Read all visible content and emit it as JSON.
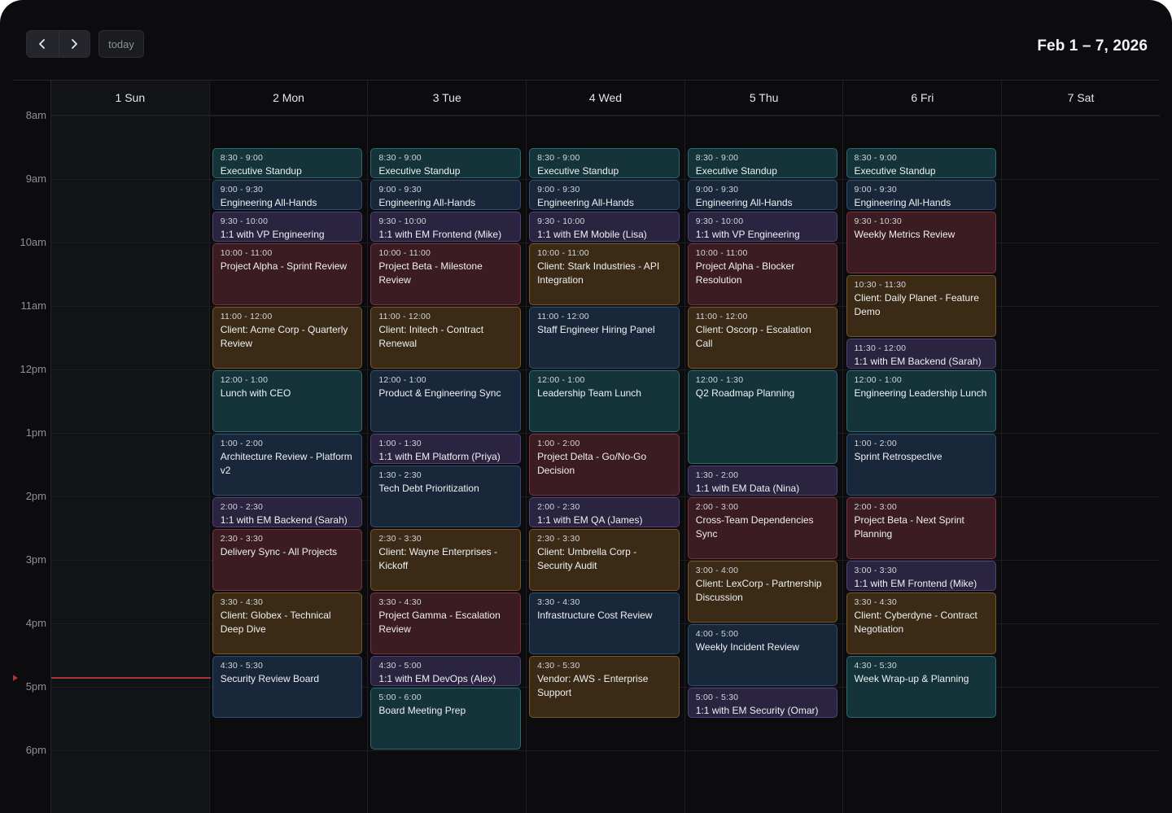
{
  "toolbar": {
    "today_label": "today",
    "range_title": "Feb 1 – 7, 2026",
    "prev_icon": "chevron-left-icon",
    "next_icon": "chevron-right-icon"
  },
  "days": [
    "1 Sun",
    "2 Mon",
    "3 Tue",
    "4 Wed",
    "5 Thu",
    "6 Fri",
    "7 Sat"
  ],
  "hours": [
    "8am",
    "9am",
    "10am",
    "11am",
    "12pm",
    "1pm",
    "2pm",
    "3pm",
    "4pm",
    "5pm",
    "6pm"
  ],
  "colors": {
    "teal": "#14343a",
    "navy": "#18283a",
    "purple": "#2a2440",
    "red": "#3a1c22",
    "amber": "#3a2a16",
    "now": "#a8353a"
  },
  "events": [
    {
      "day": 1,
      "start": 8.5,
      "end": 9,
      "time": "8:30 - 9:00",
      "title": "Executive Standup",
      "color": "teal"
    },
    {
      "day": 1,
      "start": 9,
      "end": 9.5,
      "time": "9:00 - 9:30",
      "title": "Engineering All-Hands",
      "color": "navy"
    },
    {
      "day": 1,
      "start": 9.5,
      "end": 10,
      "time": "9:30 - 10:00",
      "title": "1:1 with VP Engineering",
      "color": "purple"
    },
    {
      "day": 1,
      "start": 10,
      "end": 11,
      "time": "10:00 - 11:00",
      "title": "Project Alpha - Sprint Review",
      "color": "red"
    },
    {
      "day": 1,
      "start": 11,
      "end": 12,
      "time": "11:00 - 12:00",
      "title": "Client: Acme Corp - Quarterly Review",
      "color": "amber"
    },
    {
      "day": 1,
      "start": 12,
      "end": 13,
      "time": "12:00 - 1:00",
      "title": "Lunch with CEO",
      "color": "teal"
    },
    {
      "day": 1,
      "start": 13,
      "end": 14,
      "time": "1:00 - 2:00",
      "title": "Architecture Review - Platform v2",
      "color": "navy"
    },
    {
      "day": 1,
      "start": 14,
      "end": 14.5,
      "time": "2:00 - 2:30",
      "title": "1:1 with EM Backend (Sarah)",
      "color": "purple"
    },
    {
      "day": 1,
      "start": 14.5,
      "end": 15.5,
      "time": "2:30 - 3:30",
      "title": "Delivery Sync - All Projects",
      "color": "red"
    },
    {
      "day": 1,
      "start": 15.5,
      "end": 16.5,
      "time": "3:30 - 4:30",
      "title": "Client: Globex - Technical Deep Dive",
      "color": "amber"
    },
    {
      "day": 1,
      "start": 16.5,
      "end": 17.5,
      "time": "4:30 - 5:30",
      "title": "Security Review Board",
      "color": "navy"
    },
    {
      "day": 2,
      "start": 8.5,
      "end": 9,
      "time": "8:30 - 9:00",
      "title": "Executive Standup",
      "color": "teal"
    },
    {
      "day": 2,
      "start": 9,
      "end": 9.5,
      "time": "9:00 - 9:30",
      "title": "Engineering All-Hands",
      "color": "navy"
    },
    {
      "day": 2,
      "start": 9.5,
      "end": 10,
      "time": "9:30 - 10:00",
      "title": "1:1 with EM Frontend (Mike)",
      "color": "purple"
    },
    {
      "day": 2,
      "start": 10,
      "end": 11,
      "time": "10:00 - 11:00",
      "title": "Project Beta - Milestone Review",
      "color": "red"
    },
    {
      "day": 2,
      "start": 11,
      "end": 12,
      "time": "11:00 - 12:00",
      "title": "Client: Initech - Contract Renewal",
      "color": "amber"
    },
    {
      "day": 2,
      "start": 12,
      "end": 13,
      "time": "12:00 - 1:00",
      "title": "Product & Engineering Sync",
      "color": "navy"
    },
    {
      "day": 2,
      "start": 13,
      "end": 13.5,
      "time": "1:00 - 1:30",
      "title": "1:1 with EM Platform (Priya)",
      "color": "purple"
    },
    {
      "day": 2,
      "start": 13.5,
      "end": 14.5,
      "time": "1:30 - 2:30",
      "title": "Tech Debt Prioritization",
      "color": "navy"
    },
    {
      "day": 2,
      "start": 14.5,
      "end": 15.5,
      "time": "2:30 - 3:30",
      "title": "Client: Wayne Enterprises - Kickoff",
      "color": "amber"
    },
    {
      "day": 2,
      "start": 15.5,
      "end": 16.5,
      "time": "3:30 - 4:30",
      "title": "Project Gamma - Escalation Review",
      "color": "red"
    },
    {
      "day": 2,
      "start": 16.5,
      "end": 17,
      "time": "4:30 - 5:00",
      "title": "1:1 with EM DevOps (Alex)",
      "color": "purple"
    },
    {
      "day": 2,
      "start": 17,
      "end": 18,
      "time": "5:00 - 6:00",
      "title": "Board Meeting Prep",
      "color": "teal"
    },
    {
      "day": 3,
      "start": 8.5,
      "end": 9,
      "time": "8:30 - 9:00",
      "title": "Executive Standup",
      "color": "teal"
    },
    {
      "day": 3,
      "start": 9,
      "end": 9.5,
      "time": "9:00 - 9:30",
      "title": "Engineering All-Hands",
      "color": "navy"
    },
    {
      "day": 3,
      "start": 9.5,
      "end": 10,
      "time": "9:30 - 10:00",
      "title": "1:1 with EM Mobile (Lisa)",
      "color": "purple"
    },
    {
      "day": 3,
      "start": 10,
      "end": 11,
      "time": "10:00 - 11:00",
      "title": "Client: Stark Industries - API Integration",
      "color": "amber"
    },
    {
      "day": 3,
      "start": 11,
      "end": 12,
      "time": "11:00 - 12:00",
      "title": "Staff Engineer Hiring Panel",
      "color": "navy"
    },
    {
      "day": 3,
      "start": 12,
      "end": 13,
      "time": "12:00 - 1:00",
      "title": "Leadership Team Lunch",
      "color": "teal"
    },
    {
      "day": 3,
      "start": 13,
      "end": 14,
      "time": "1:00 - 2:00",
      "title": "Project Delta - Go/No-Go Decision",
      "color": "red"
    },
    {
      "day": 3,
      "start": 14,
      "end": 14.5,
      "time": "2:00 - 2:30",
      "title": "1:1 with EM QA (James)",
      "color": "purple"
    },
    {
      "day": 3,
      "start": 14.5,
      "end": 15.5,
      "time": "2:30 - 3:30",
      "title": "Client: Umbrella Corp - Security Audit",
      "color": "amber"
    },
    {
      "day": 3,
      "start": 15.5,
      "end": 16.5,
      "time": "3:30 - 4:30",
      "title": "Infrastructure Cost Review",
      "color": "navy"
    },
    {
      "day": 3,
      "start": 16.5,
      "end": 17.5,
      "time": "4:30 - 5:30",
      "title": "Vendor: AWS - Enterprise Support",
      "color": "amber"
    },
    {
      "day": 4,
      "start": 8.5,
      "end": 9,
      "time": "8:30 - 9:00",
      "title": "Executive Standup",
      "color": "teal"
    },
    {
      "day": 4,
      "start": 9,
      "end": 9.5,
      "time": "9:00 - 9:30",
      "title": "Engineering All-Hands",
      "color": "navy"
    },
    {
      "day": 4,
      "start": 9.5,
      "end": 10,
      "time": "9:30 - 10:00",
      "title": "1:1 with VP Engineering",
      "color": "purple"
    },
    {
      "day": 4,
      "start": 10,
      "end": 11,
      "time": "10:00 - 11:00",
      "title": "Project Alpha - Blocker Resolution",
      "color": "red"
    },
    {
      "day": 4,
      "start": 11,
      "end": 12,
      "time": "11:00 - 12:00",
      "title": "Client: Oscorp - Escalation Call",
      "color": "amber"
    },
    {
      "day": 4,
      "start": 12,
      "end": 13.5,
      "time": "12:00 - 1:30",
      "title": "Q2 Roadmap Planning",
      "color": "teal"
    },
    {
      "day": 4,
      "start": 13.5,
      "end": 14,
      "time": "1:30 - 2:00",
      "title": "1:1 with EM Data (Nina)",
      "color": "purple"
    },
    {
      "day": 4,
      "start": 14,
      "end": 15,
      "time": "2:00 - 3:00",
      "title": "Cross-Team Dependencies Sync",
      "color": "red"
    },
    {
      "day": 4,
      "start": 15,
      "end": 16,
      "time": "3:00 - 4:00",
      "title": "Client: LexCorp - Partnership Discussion",
      "color": "amber"
    },
    {
      "day": 4,
      "start": 16,
      "end": 17,
      "time": "4:00 - 5:00",
      "title": "Weekly Incident Review",
      "color": "navy"
    },
    {
      "day": 4,
      "start": 17,
      "end": 17.5,
      "time": "5:00 - 5:30",
      "title": "1:1 with EM Security (Omar)",
      "color": "purple"
    },
    {
      "day": 5,
      "start": 8.5,
      "end": 9,
      "time": "8:30 - 9:00",
      "title": "Executive Standup",
      "color": "teal"
    },
    {
      "day": 5,
      "start": 9,
      "end": 9.5,
      "time": "9:00 - 9:30",
      "title": "Engineering All-Hands",
      "color": "navy"
    },
    {
      "day": 5,
      "start": 9.5,
      "end": 10.5,
      "time": "9:30 - 10:30",
      "title": "Weekly Metrics Review",
      "color": "red"
    },
    {
      "day": 5,
      "start": 10.5,
      "end": 11.5,
      "time": "10:30 - 11:30",
      "title": "Client: Daily Planet - Feature Demo",
      "color": "amber"
    },
    {
      "day": 5,
      "start": 11.5,
      "end": 12,
      "time": "11:30 - 12:00",
      "title": "1:1 with EM Backend (Sarah)",
      "color": "purple"
    },
    {
      "day": 5,
      "start": 12,
      "end": 13,
      "time": "12:00 - 1:00",
      "title": "Engineering Leadership Lunch",
      "color": "teal"
    },
    {
      "day": 5,
      "start": 13,
      "end": 14,
      "time": "1:00 - 2:00",
      "title": "Sprint Retrospective",
      "color": "navy"
    },
    {
      "day": 5,
      "start": 14,
      "end": 15,
      "time": "2:00 - 3:00",
      "title": "Project Beta - Next Sprint Planning",
      "color": "red"
    },
    {
      "day": 5,
      "start": 15,
      "end": 15.5,
      "time": "3:00 - 3:30",
      "title": "1:1 with EM Frontend (Mike)",
      "color": "purple"
    },
    {
      "day": 5,
      "start": 15.5,
      "end": 16.5,
      "time": "3:30 - 4:30",
      "title": "Client: Cyberdyne - Contract Negotiation",
      "color": "amber"
    },
    {
      "day": 5,
      "start": 16.5,
      "end": 17.5,
      "time": "4:30 - 5:30",
      "title": "Week Wrap-up & Planning",
      "color": "teal"
    }
  ],
  "now_time": 16.85
}
